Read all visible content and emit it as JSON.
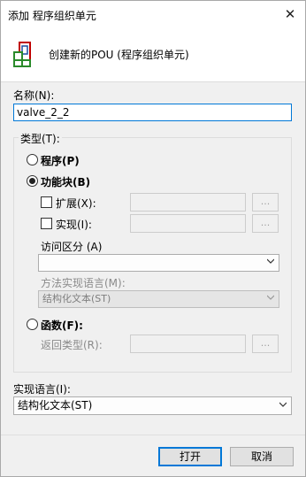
{
  "window": {
    "title": "添加 程序组织单元",
    "close_glyph": "✕"
  },
  "header": {
    "text": "创建新的POU (程序组织单元)"
  },
  "name": {
    "label": "名称(N):",
    "value": "valve_2_2"
  },
  "type_group": {
    "caption": "类型(T):",
    "program_label": "程序(P)",
    "function_block_label": "功能块(B)",
    "extends_label": "扩展(X):",
    "implements_label": "实现(I):",
    "access_label": "访问区分 (A)",
    "access_value": "",
    "method_lang_label": "方法实现语言(M):",
    "method_lang_value": "结构化文本(ST)",
    "function_label": "函数(F):",
    "return_type_label": "返回类型(R):",
    "browse_glyph": "...",
    "selected": "function_block"
  },
  "implementation_language": {
    "label": "实现语言(I):",
    "value": "结构化文本(ST)"
  },
  "footer": {
    "open_label": "打开",
    "cancel_label": "取消"
  },
  "colors": {
    "accent": "#0078d7",
    "dialog_bg": "#f0f0f0"
  }
}
